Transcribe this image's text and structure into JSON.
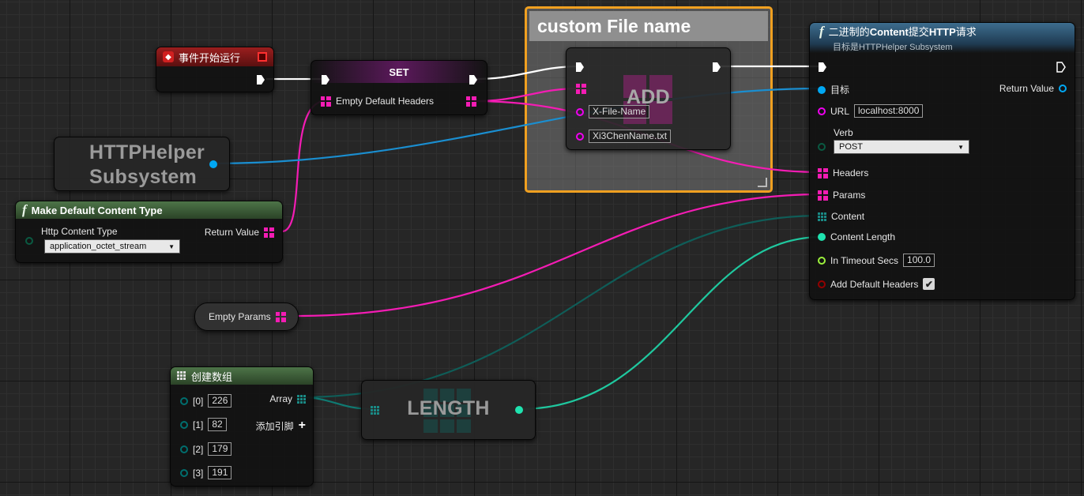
{
  "event_node": {
    "title": "事件开始运行"
  },
  "set_node": {
    "title": "SET",
    "var_label": "Empty Default Headers"
  },
  "comment": {
    "title": "custom File name"
  },
  "add_node": {
    "title": "ADD",
    "key": "X-File-Name",
    "value": "Xi3ChenName.txt"
  },
  "http_node": {
    "title_prefix": "二进制的",
    "title_bold": "Content",
    "title_mid": "提交",
    "title_bold2": "HTTP",
    "title_suffix": "请求",
    "subtitle": "目标是HTTPHelper Subsystem",
    "target_label": "目标",
    "return_label": "Return Value",
    "url_label": "URL",
    "url_value": "localhost:8000",
    "verb_label": "Verb",
    "verb_value": "POST",
    "headers_label": "Headers",
    "params_label": "Params",
    "content_label": "Content",
    "content_length_label": "Content Length",
    "timeout_label": "In Timeout Secs",
    "timeout_value": "100.0",
    "add_default_headers_label": "Add Default Headers",
    "add_default_headers_checked": true
  },
  "subsystem_node": {
    "title_line1": "HTTPHelper",
    "title_line2": "Subsystem"
  },
  "make_content_node": {
    "title": "Make Default Content Type",
    "input_label": "Http Content Type",
    "input_value": "application_octet_stream",
    "return_label": "Return Value"
  },
  "empty_params_node": {
    "label": "Empty Params"
  },
  "array_node": {
    "title": "创建数组",
    "items": [
      {
        "index": "[0]",
        "value": "226"
      },
      {
        "index": "[1]",
        "value": "82"
      },
      {
        "index": "[2]",
        "value": "179"
      },
      {
        "index": "[3]",
        "value": "191"
      }
    ],
    "array_label": "Array",
    "add_pin_label": "添加引脚"
  },
  "length_node": {
    "title": "LENGTH"
  },
  "colors": {
    "exec": "#ffffff",
    "object": "#00a8f4",
    "map": "#f41cb4",
    "string": "#f000f0",
    "byte": "#006e6e",
    "int": "#1fe3af",
    "float": "#9cf13c",
    "bool": "#940000",
    "comment_border": "#f0a020"
  }
}
